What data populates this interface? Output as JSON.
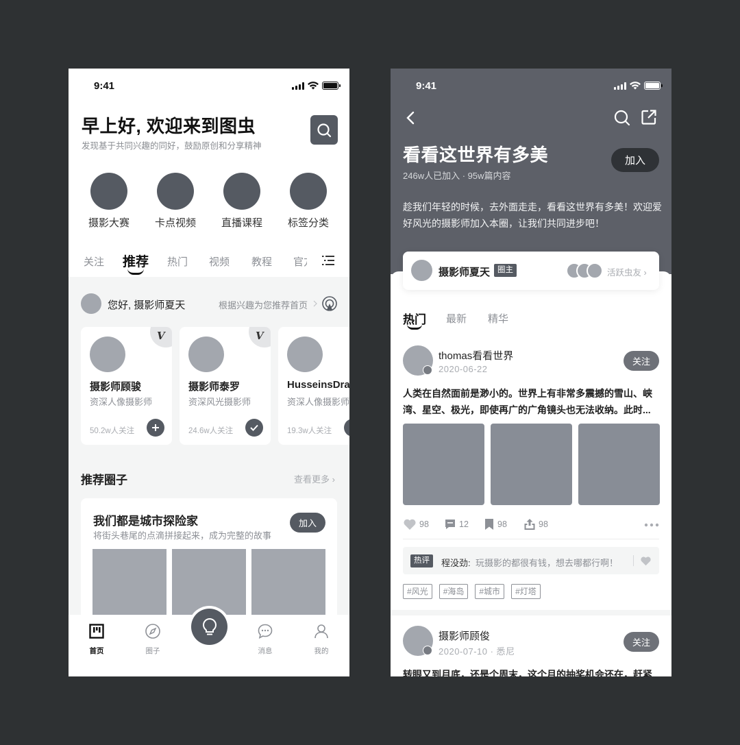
{
  "left": {
    "status_time": "9:41",
    "greeting_title": "早上好, 欢迎来到图虫",
    "greeting_sub": "发现基于共同兴趣的同好，鼓励原创和分享精神",
    "categories": [
      "摄影大赛",
      "卡点视频",
      "直播课程",
      "标签分类"
    ],
    "tabs": [
      "关注",
      "推荐",
      "热门",
      "视频",
      "教程",
      "官方"
    ],
    "hello": "您好, 摄影师夏天",
    "hello_hint": "根据兴趣为您推荐首页",
    "photographers": [
      {
        "name": "摄影师顾骏",
        "desc": "资深人像摄影师",
        "followers": "50.2w人关注",
        "verified": true,
        "action": "add"
      },
      {
        "name": "摄影师泰罗",
        "desc": "资深风光摄影师",
        "followers": "24.6w人关注",
        "verified": true,
        "action": "check"
      },
      {
        "name": "HusseinsDrama",
        "desc": "资深人像摄影师",
        "followers": "19.3w人关注",
        "verified": false,
        "action": "add"
      }
    ],
    "section_title": "推荐圈子",
    "see_more": "查看更多",
    "circle": {
      "title": "我们都是城市探险家",
      "sub": "将街头巷尾的点滴拼接起来，成为完整的故事",
      "join": "加入"
    },
    "tabbar": [
      "首页",
      "圈子",
      "消息",
      "我的"
    ]
  },
  "right": {
    "status_time": "9:41",
    "title": "看看这世界有多美",
    "meta": "246w人已加入 · 95w篇内容",
    "join": "加入",
    "desc": "趁我们年轻的时候，去外面走走，看看这世界有多美！欢迎爱好风光的摄影师加入本圈，让我们共同进步吧！",
    "owner": {
      "name": "摄影师夏天",
      "badge": "圈主",
      "active": "活跃虫友"
    },
    "tabs": [
      "热门",
      "最新",
      "精华"
    ],
    "post1": {
      "user": "thomas看看世界",
      "date": "2020-06-22",
      "follow": "关注",
      "text": "人类在自然面前是渺小的。世界上有非常多震撼的雪山、峡湾、星空、极光，即使再广的广角镜头也无法收纳。此时...",
      "likes": "98",
      "comments": "12",
      "favs": "98",
      "shares": "98",
      "hot_badge": "热评",
      "hot_user": "程没劲:",
      "hot_text": "玩摄影的都很有钱，想去哪都行啊！",
      "tags": [
        "#风光",
        "#海岛",
        "#城市",
        "#灯塔"
      ]
    },
    "post2": {
      "user": "摄影师顾俊",
      "date": "2020-07-10 · 悉尼",
      "follow": "关注",
      "text": "转眼又到月底，还是个周末，这个月的抽奖机会还在，赶紧"
    }
  }
}
